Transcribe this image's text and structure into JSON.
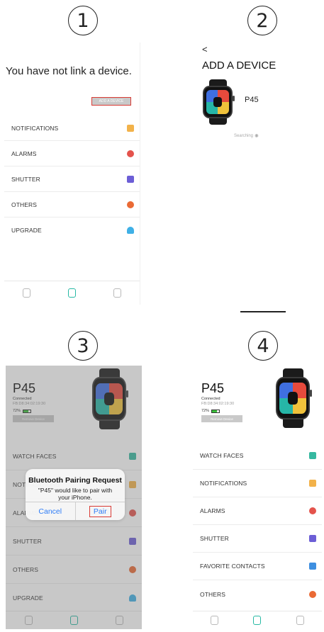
{
  "steps": [
    "1",
    "2",
    "3",
    "4"
  ],
  "panel1": {
    "heading": "You have not link a device.",
    "add_device_label": "ADD A DEVICE",
    "items": [
      {
        "label": "NOTIFICATIONS",
        "icon": "message-icon",
        "color": "#f2b24a"
      },
      {
        "label": "ALARMS",
        "icon": "clock-icon",
        "color": "#e4534c"
      },
      {
        "label": "SHUTTER",
        "icon": "camera-icon",
        "color": "#6c5ed6"
      },
      {
        "label": "OTHERS",
        "icon": "gear-icon",
        "color": "#ea6a35"
      },
      {
        "label": "UPGRADE",
        "icon": "cloud-upload-icon",
        "color": "#3fb0e6"
      }
    ]
  },
  "panel2": {
    "back": "<",
    "title": "ADD A DEVICE",
    "device_name": "P45",
    "status": "Searching"
  },
  "panel3": {
    "device_name": "P45",
    "connection": "Connected",
    "timestamp": "FB:D8:34:02:19:30",
    "battery": "72%",
    "remove_label": "Remove Device",
    "items": [
      {
        "label": "WATCH FACES",
        "icon": "watch-face-icon",
        "color": "#36b8a0"
      },
      {
        "label": "NOTIFICATIONS",
        "icon": "message-icon",
        "color": "#f2b24a"
      },
      {
        "label": "ALARMS",
        "icon": "clock-icon",
        "color": "#e4534c"
      },
      {
        "label": "SHUTTER",
        "icon": "camera-icon",
        "color": "#6c5ed6"
      },
      {
        "label": "OTHERS",
        "icon": "gear-icon",
        "color": "#ea6a35"
      },
      {
        "label": "UPGRADE",
        "icon": "cloud-upload-icon",
        "color": "#3fb0e6"
      }
    ],
    "alert": {
      "title": "Bluetooth Pairing Request",
      "message": "\"P45\" would like to pair with your iPhone.",
      "cancel": "Cancel",
      "pair": "Pair"
    }
  },
  "panel4": {
    "device_name": "P45",
    "connection": "Connected",
    "timestamp": "FB:D8:34:02:19:30",
    "battery": "72%",
    "remove_label": "Remove Device",
    "items": [
      {
        "label": "WATCH FACES",
        "icon": "watch-face-icon",
        "color": "#36b8a0"
      },
      {
        "label": "NOTIFICATIONS",
        "icon": "message-icon",
        "color": "#f2b24a"
      },
      {
        "label": "ALARMS",
        "icon": "clock-icon",
        "color": "#e4534c"
      },
      {
        "label": "SHUTTER",
        "icon": "camera-icon",
        "color": "#6c5ed6"
      },
      {
        "label": "FAVORITE CONTACTS",
        "icon": "contacts-icon",
        "color": "#3e8fe0"
      },
      {
        "label": "OTHERS",
        "icon": "gear-icon",
        "color": "#ea6a35"
      }
    ]
  },
  "colors": {
    "accent": "#27b9a4",
    "highlight_box": "#d93b35",
    "link_blue": "#2d7cf6"
  }
}
